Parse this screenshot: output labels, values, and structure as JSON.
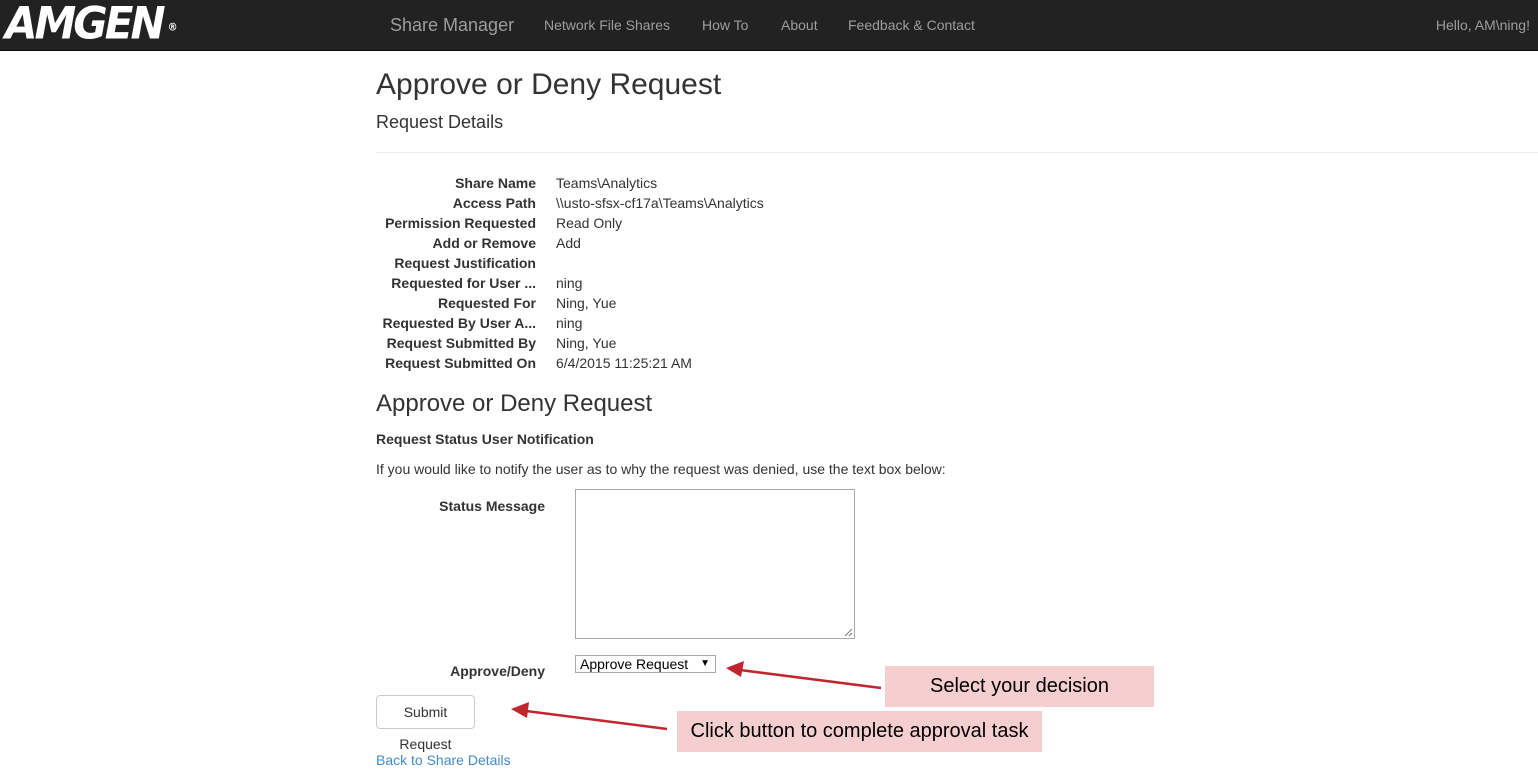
{
  "navbar": {
    "logo_text": "AMGEN",
    "logo_mark": "®",
    "brand": "Share Manager",
    "links": [
      {
        "label": "Network File Shares"
      },
      {
        "label": "How To"
      },
      {
        "label": "About"
      },
      {
        "label": "Feedback & Contact"
      }
    ],
    "greeting": "Hello, AM\\ning!"
  },
  "page": {
    "title": "Approve or Deny Request",
    "subtitle": "Request Details"
  },
  "details": [
    {
      "label": "Share Name",
      "value": "Teams\\Analytics"
    },
    {
      "label": "Access Path",
      "value": "\\\\usto-sfsx-cf17a\\Teams\\Analytics"
    },
    {
      "label": "Permission Requested",
      "value": "Read Only"
    },
    {
      "label": "Add or Remove",
      "value": "Add"
    },
    {
      "label": "Request Justification",
      "value": ""
    },
    {
      "label": "Requested for User ...",
      "value": "ning"
    },
    {
      "label": "Requested For",
      "value": "Ning, Yue"
    },
    {
      "label": "Requested By User A...",
      "value": "ning"
    },
    {
      "label": "Request Submitted By",
      "value": "Ning, Yue"
    },
    {
      "label": "Request Submitted On",
      "value": "6/4/2015 11:25:21 AM"
    }
  ],
  "decision": {
    "section_title": "Approve or Deny Request",
    "notification_title": "Request Status User Notification",
    "help_text": "If you would like to notify the user as to why the request was denied, use the text box below:",
    "status_label": "Status Message",
    "status_value": "",
    "approve_label": "Approve/Deny",
    "selected_option": "Approve Request",
    "submit_label": "Submit Request",
    "back_link": "Back to Share Details"
  },
  "annotations": {
    "select_callout": "Select your decision",
    "submit_callout": "Click button to complete approval task",
    "arrow_color": "#c0262d",
    "callout_color": "#f5cfd0"
  },
  "colors": {
    "navbar_bg": "#222222",
    "nav_text": "#9d9d9d",
    "link": "#428bca"
  }
}
